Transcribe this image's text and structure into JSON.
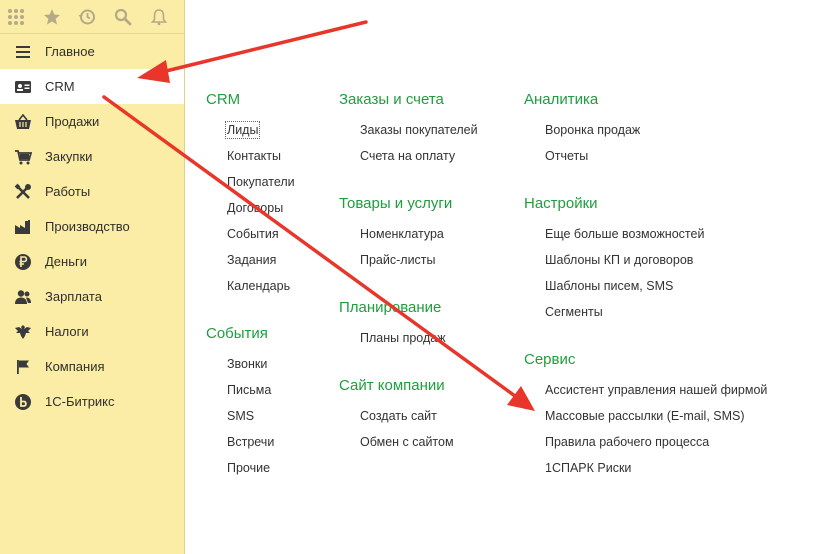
{
  "toolbar": {
    "icons": [
      "apps-grid-icon",
      "star-icon",
      "history-icon",
      "search-icon",
      "bell-icon"
    ]
  },
  "sidebar": {
    "items": [
      {
        "label": "Главное",
        "icon": "menu-lines-icon"
      },
      {
        "label": "CRM",
        "icon": "contact-card-icon",
        "active": true
      },
      {
        "label": "Продажи",
        "icon": "basket-icon"
      },
      {
        "label": "Закупки",
        "icon": "cart-icon"
      },
      {
        "label": "Работы",
        "icon": "tools-icon"
      },
      {
        "label": "Производство",
        "icon": "factory-icon"
      },
      {
        "label": "Деньги",
        "icon": "ruble-coin-icon"
      },
      {
        "label": "Зарплата",
        "icon": "people-icon"
      },
      {
        "label": "Налоги",
        "icon": "eagle-icon"
      },
      {
        "label": "Компания",
        "icon": "flag-icon"
      },
      {
        "label": "1С-Битрикс",
        "icon": "bitrix-icon"
      }
    ]
  },
  "main": {
    "sections": {
      "crm": {
        "title": "CRM",
        "items": [
          "Лиды",
          "Контакты",
          "Покупатели",
          "Договоры",
          "События",
          "Задания",
          "Календарь"
        ]
      },
      "events": {
        "title": "События",
        "items": [
          "Звонки",
          "Письма",
          "SMS",
          "Встречи",
          "Прочие"
        ]
      },
      "orders": {
        "title": "Заказы и счета",
        "items": [
          "Заказы покупателей",
          "Счета на оплату"
        ]
      },
      "goods": {
        "title": "Товары и услуги",
        "items": [
          "Номенклатура",
          "Прайс-листы"
        ]
      },
      "planning": {
        "title": "Планирование",
        "items": [
          "Планы продаж"
        ]
      },
      "site": {
        "title": "Сайт компании",
        "items": [
          "Создать сайт",
          "Обмен с сайтом"
        ]
      },
      "analytics": {
        "title": "Аналитика",
        "items": [
          "Воронка продаж",
          "Отчеты"
        ]
      },
      "settings": {
        "title": "Настройки",
        "items": [
          "Еще больше возможностей",
          "Шаблоны КП и договоров",
          "Шаблоны писем, SMS",
          "Сегменты"
        ]
      },
      "service": {
        "title": "Сервис",
        "items": [
          "Ассистент управления нашей фирмой",
          "Массовые рассылки (E-mail, SMS)",
          "Правила рабочего процесса",
          "1СПАРК Риски"
        ]
      }
    }
  },
  "colors": {
    "sidebar_bg": "#fbeda5",
    "section_title": "#1f9e3e",
    "arrow": "#e8372a"
  }
}
